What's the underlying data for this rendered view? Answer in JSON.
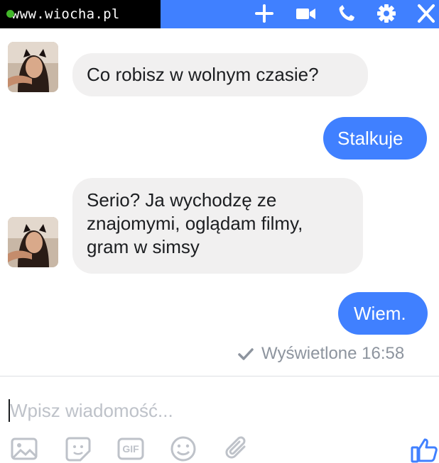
{
  "header": {
    "watermark": "www.wiocha.pl",
    "icons": [
      "plus-icon",
      "video-icon",
      "phone-icon",
      "gear-icon",
      "close-icon"
    ],
    "color": "#4080ff"
  },
  "messages": [
    {
      "direction": "incoming",
      "text": "Co robisz w wolnym czasie?"
    },
    {
      "direction": "outgoing",
      "text": "Stalkuje"
    },
    {
      "direction": "incoming",
      "lines": [
        "Serio? Ja wychodzę ze",
        "znajomymi, oglądam filmy,",
        "gram w simsy"
      ]
    },
    {
      "direction": "outgoing",
      "text": "Wiem."
    }
  ],
  "status": {
    "seen_text": "Wyświetlone 16:58"
  },
  "composer": {
    "placeholder": "Wpisz wiadomość...",
    "gif_label": "GIF",
    "tools": [
      "image-icon",
      "sticker-icon",
      "gif-icon",
      "emoji-icon",
      "attachment-icon",
      "like-icon"
    ]
  },
  "colors": {
    "accent": "#4080ff",
    "incoming_bubble": "#f1f0f0",
    "muted": "#bec2c9"
  }
}
